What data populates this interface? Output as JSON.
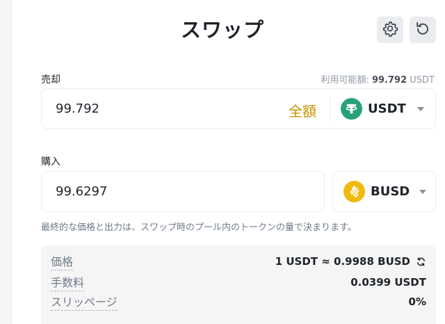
{
  "header": {
    "title": "スワップ",
    "settings_icon": "gear-icon",
    "refresh_icon": "refresh-icon"
  },
  "sell": {
    "label": "売却",
    "available_label": "利用可能額:",
    "available_value": "99.792",
    "available_unit": "USDT",
    "amount": "99.792",
    "max_label": "全額",
    "token": "USDT",
    "token_icon": "tether-icon"
  },
  "buy": {
    "label": "購入",
    "amount": "99.6297",
    "token": "BUSD",
    "token_icon": "busd-icon"
  },
  "note": "最終的な価格と出力は、スワップ時のプール内のトークンの量で決まります。",
  "details": {
    "price_label": "価格",
    "price_value": "1 USDT ≈ 0.9988 BUSD",
    "fee_label": "手数料",
    "fee_value": "0.0399 USDT",
    "slippage_label": "スリッページ",
    "slippage_value": "0%"
  },
  "colors": {
    "accent": "#c99400",
    "usdt": "#26a17b",
    "busd": "#f0b90b",
    "border": "#eaecef",
    "panel": "#f5f5f5"
  }
}
